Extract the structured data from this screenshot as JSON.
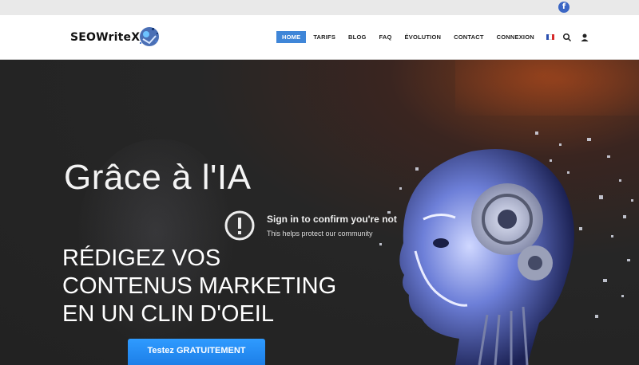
{
  "topbar": {
    "facebook_icon": "facebook-icon",
    "facebook_glyph": "f"
  },
  "header": {
    "logo_text": "SEOWriteX",
    "nav": [
      "HOME",
      "TARIFS",
      "BLOG",
      "FAQ",
      "ÉVOLUTION",
      "CONTACT",
      "CONNEXION"
    ],
    "active_item": "HOME",
    "language_flag": "french-flag-icon",
    "search_icon": "search-icon",
    "user_icon": "user-icon"
  },
  "hero": {
    "subtitle": "Grâce à l'IA",
    "title_lines": [
      "RÉDIGEZ VOS",
      "CONTENUS MARKETING",
      "EN UN CLIN D'OEIL"
    ],
    "cta_label": "Testez GRATUITEMENT"
  },
  "overlay": {
    "title": "Sign in to confirm you're not",
    "subtitle": "This helps protect our community"
  },
  "colors": {
    "accent": "#3f86d8",
    "cta": "#2f9bff",
    "facebook": "#3b66c4"
  }
}
